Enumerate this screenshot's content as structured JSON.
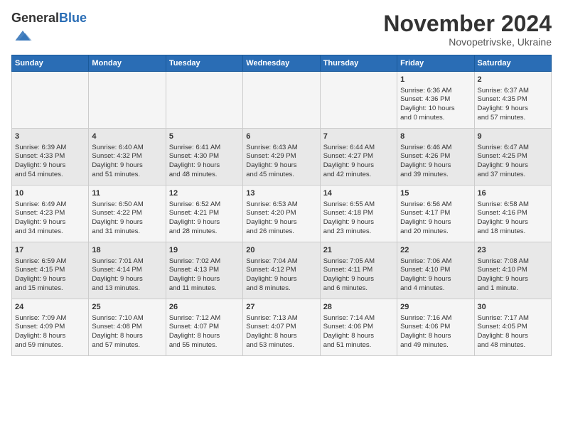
{
  "logo": {
    "general": "General",
    "blue": "Blue"
  },
  "title": "November 2024",
  "subtitle": "Novopetrivske, Ukraine",
  "days_header": [
    "Sunday",
    "Monday",
    "Tuesday",
    "Wednesday",
    "Thursday",
    "Friday",
    "Saturday"
  ],
  "weeks": [
    [
      {
        "day": "",
        "info": ""
      },
      {
        "day": "",
        "info": ""
      },
      {
        "day": "",
        "info": ""
      },
      {
        "day": "",
        "info": ""
      },
      {
        "day": "",
        "info": ""
      },
      {
        "day": "1",
        "info": "Sunrise: 6:36 AM\nSunset: 4:36 PM\nDaylight: 10 hours\nand 0 minutes."
      },
      {
        "day": "2",
        "info": "Sunrise: 6:37 AM\nSunset: 4:35 PM\nDaylight: 9 hours\nand 57 minutes."
      }
    ],
    [
      {
        "day": "3",
        "info": "Sunrise: 6:39 AM\nSunset: 4:33 PM\nDaylight: 9 hours\nand 54 minutes."
      },
      {
        "day": "4",
        "info": "Sunrise: 6:40 AM\nSunset: 4:32 PM\nDaylight: 9 hours\nand 51 minutes."
      },
      {
        "day": "5",
        "info": "Sunrise: 6:41 AM\nSunset: 4:30 PM\nDaylight: 9 hours\nand 48 minutes."
      },
      {
        "day": "6",
        "info": "Sunrise: 6:43 AM\nSunset: 4:29 PM\nDaylight: 9 hours\nand 45 minutes."
      },
      {
        "day": "7",
        "info": "Sunrise: 6:44 AM\nSunset: 4:27 PM\nDaylight: 9 hours\nand 42 minutes."
      },
      {
        "day": "8",
        "info": "Sunrise: 6:46 AM\nSunset: 4:26 PM\nDaylight: 9 hours\nand 39 minutes."
      },
      {
        "day": "9",
        "info": "Sunrise: 6:47 AM\nSunset: 4:25 PM\nDaylight: 9 hours\nand 37 minutes."
      }
    ],
    [
      {
        "day": "10",
        "info": "Sunrise: 6:49 AM\nSunset: 4:23 PM\nDaylight: 9 hours\nand 34 minutes."
      },
      {
        "day": "11",
        "info": "Sunrise: 6:50 AM\nSunset: 4:22 PM\nDaylight: 9 hours\nand 31 minutes."
      },
      {
        "day": "12",
        "info": "Sunrise: 6:52 AM\nSunset: 4:21 PM\nDaylight: 9 hours\nand 28 minutes."
      },
      {
        "day": "13",
        "info": "Sunrise: 6:53 AM\nSunset: 4:20 PM\nDaylight: 9 hours\nand 26 minutes."
      },
      {
        "day": "14",
        "info": "Sunrise: 6:55 AM\nSunset: 4:18 PM\nDaylight: 9 hours\nand 23 minutes."
      },
      {
        "day": "15",
        "info": "Sunrise: 6:56 AM\nSunset: 4:17 PM\nDaylight: 9 hours\nand 20 minutes."
      },
      {
        "day": "16",
        "info": "Sunrise: 6:58 AM\nSunset: 4:16 PM\nDaylight: 9 hours\nand 18 minutes."
      }
    ],
    [
      {
        "day": "17",
        "info": "Sunrise: 6:59 AM\nSunset: 4:15 PM\nDaylight: 9 hours\nand 15 minutes."
      },
      {
        "day": "18",
        "info": "Sunrise: 7:01 AM\nSunset: 4:14 PM\nDaylight: 9 hours\nand 13 minutes."
      },
      {
        "day": "19",
        "info": "Sunrise: 7:02 AM\nSunset: 4:13 PM\nDaylight: 9 hours\nand 11 minutes."
      },
      {
        "day": "20",
        "info": "Sunrise: 7:04 AM\nSunset: 4:12 PM\nDaylight: 9 hours\nand 8 minutes."
      },
      {
        "day": "21",
        "info": "Sunrise: 7:05 AM\nSunset: 4:11 PM\nDaylight: 9 hours\nand 6 minutes."
      },
      {
        "day": "22",
        "info": "Sunrise: 7:06 AM\nSunset: 4:10 PM\nDaylight: 9 hours\nand 4 minutes."
      },
      {
        "day": "23",
        "info": "Sunrise: 7:08 AM\nSunset: 4:10 PM\nDaylight: 9 hours\nand 1 minute."
      }
    ],
    [
      {
        "day": "24",
        "info": "Sunrise: 7:09 AM\nSunset: 4:09 PM\nDaylight: 8 hours\nand 59 minutes."
      },
      {
        "day": "25",
        "info": "Sunrise: 7:10 AM\nSunset: 4:08 PM\nDaylight: 8 hours\nand 57 minutes."
      },
      {
        "day": "26",
        "info": "Sunrise: 7:12 AM\nSunset: 4:07 PM\nDaylight: 8 hours\nand 55 minutes."
      },
      {
        "day": "27",
        "info": "Sunrise: 7:13 AM\nSunset: 4:07 PM\nDaylight: 8 hours\nand 53 minutes."
      },
      {
        "day": "28",
        "info": "Sunrise: 7:14 AM\nSunset: 4:06 PM\nDaylight: 8 hours\nand 51 minutes."
      },
      {
        "day": "29",
        "info": "Sunrise: 7:16 AM\nSunset: 4:06 PM\nDaylight: 8 hours\nand 49 minutes."
      },
      {
        "day": "30",
        "info": "Sunrise: 7:17 AM\nSunset: 4:05 PM\nDaylight: 8 hours\nand 48 minutes."
      }
    ]
  ]
}
